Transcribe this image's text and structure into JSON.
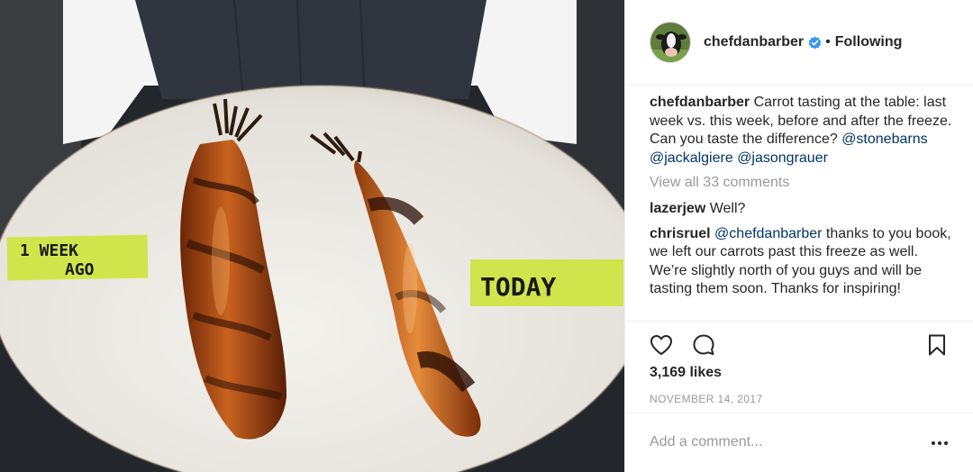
{
  "post": {
    "photo": {
      "sign_left_line1": "1 WEEK",
      "sign_left_line2": "AGO",
      "sign_right": "TODAY"
    }
  },
  "header": {
    "username": "chefdanbarber",
    "separator": "•",
    "follow_state": "Following",
    "verified_icon": "verified-badge-icon",
    "avatar_icon": "cow-avatar"
  },
  "caption": {
    "username": "chefdanbarber",
    "text": " Carrot tasting at the table: last week vs. this week, before and after the freeze. Can you taste the difference? ",
    "mentions": [
      "@stonebarns",
      "@jackalgiere",
      "@jasongrauer"
    ]
  },
  "view_all_comments": "View all 33 comments",
  "comments": [
    {
      "username": "lazerjew",
      "text": " Well?"
    },
    {
      "username": "chrisruel",
      "mention": "@chefdanbarber",
      "text": " thanks to you book, we left our carrots past this freeze as well. We’re slightly north of you guys and will be tasting them soon. Thanks for inspiring!"
    }
  ],
  "actions": {
    "like_icon": "heart-icon",
    "comment_icon": "comment-icon",
    "save_icon": "bookmark-icon"
  },
  "likes": "3,169 likes",
  "date": "NOVEMBER 14, 2017",
  "add_comment": {
    "placeholder": "Add a comment...",
    "more_icon": "more-options-icon"
  },
  "colors": {
    "mention": "#003569",
    "secondary": "#999999",
    "verified": "#3897f0",
    "text": "#262626"
  }
}
